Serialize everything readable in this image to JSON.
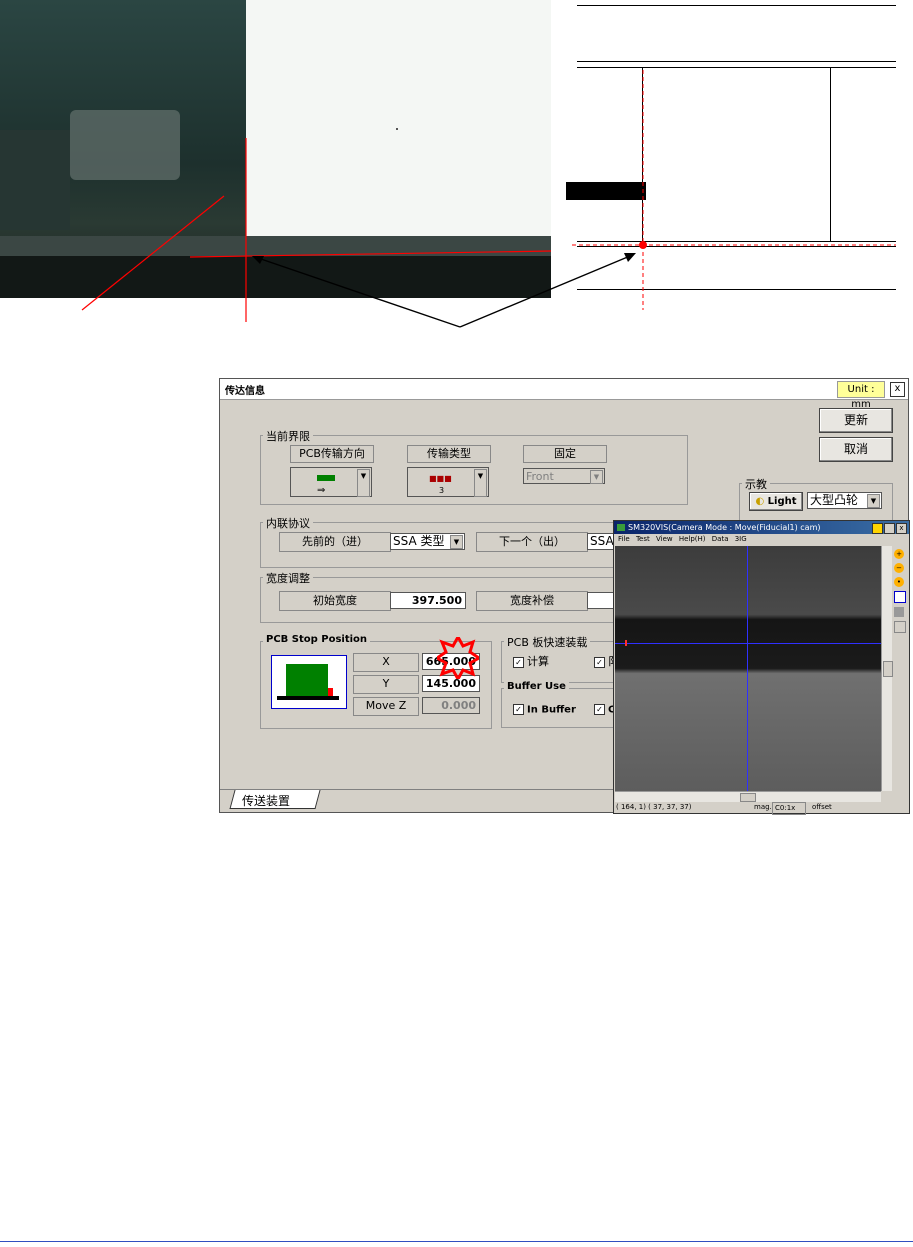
{
  "dialog": {
    "title": "传达信息",
    "unit_label": "Unit : mm",
    "close_label": "x",
    "update_button": "更新",
    "cancel_button": "取消",
    "current_limit": {
      "group_label": "当前界限",
      "pcb_direction_label": "PCB传输方向",
      "transfer_type_label": "传输类型",
      "transfer_type_value": "3",
      "fixed_label": "固定",
      "fixed_value": "Front"
    },
    "teach": {
      "group_label": "示教",
      "light_button": "Light",
      "light_select_value": "大型凸轮"
    },
    "inline_protocol": {
      "group_label": "内联协议",
      "previous_label": "先前的（进）",
      "previous_value": "SSA 类型",
      "next_label": "下一个（出）",
      "next_value": "SSA"
    },
    "width_adjust": {
      "group_label": "宽度调整",
      "initial_width_label": "初始宽度",
      "initial_width_value": "397.500",
      "width_comp_label": "宽度补偿",
      "width_comp_value": ""
    },
    "pcb_stop": {
      "group_label": "PCB Stop Position",
      "x_label": "X",
      "x_value": "665.000",
      "y_label": "Y",
      "y_value": "145.000",
      "movez_label": "Move Z",
      "movez_value": "0.000"
    },
    "fast_load": {
      "group_label": "PCB 板快速装载",
      "calc_label": "计算",
      "calc_checked": true,
      "second_checked": true,
      "second_label": "阝"
    },
    "buffer_use": {
      "group_label": "Buffer Use",
      "in_buffer_label": "In Buffer",
      "in_buffer_checked": true,
      "second_label": "C",
      "second_checked": true
    },
    "tab_label": "传送装置"
  },
  "camera": {
    "title": "SM320VIS(Camera Mode : Move(Fiducial1) cam)",
    "menu": [
      "File",
      "Test",
      "View",
      "Help(H)",
      "Data",
      "3IG"
    ],
    "status_coords": "( 164,   1) ( 37, 37, 37)",
    "status_mag": "mag.",
    "status_zoom": "C0:1x",
    "status_offset": "offset"
  },
  "icons": {
    "checkbox_checked": "check-icon",
    "light": "lamp-icon",
    "direction": "arrow-right-icon",
    "callout": "starburst-icon"
  },
  "colors": {
    "dialog_bg": "#d4d0c8",
    "unit_highlight": "#ffff99",
    "marker_red": "#ff0000",
    "pcb_green": "#008000",
    "cam_title_blue": "#0a246a"
  }
}
